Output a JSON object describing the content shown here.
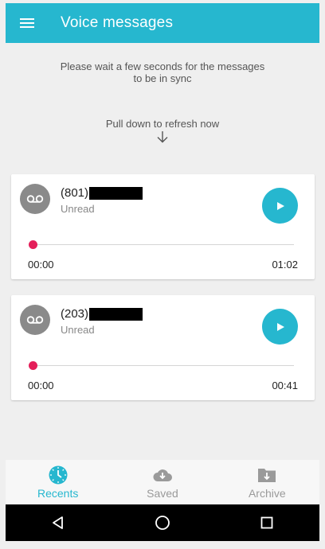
{
  "appbar": {
    "title": "Voice messages"
  },
  "notice": {
    "sync_line1": "Please wait a few seconds for the messages",
    "sync_line2": "to be in sync",
    "refresh": "Pull down to refresh now"
  },
  "messages": [
    {
      "caller": "(801)",
      "status": "Unread",
      "elapsed": "00:00",
      "duration": "01:02",
      "progress": 0
    },
    {
      "caller": "(203)",
      "status": "Unread",
      "elapsed": "00:00",
      "duration": "00:41",
      "progress": 0
    }
  ],
  "nav": {
    "items": [
      {
        "label": "Recents",
        "icon": "clock-icon",
        "active": true
      },
      {
        "label": "Saved",
        "icon": "cloud-download-icon",
        "active": false
      },
      {
        "label": "Archive",
        "icon": "archive-folder-icon",
        "active": false
      }
    ]
  },
  "system_nav": [
    "back-icon",
    "home-icon",
    "recents-icon"
  ],
  "colors": {
    "accent": "#26b7cf",
    "progress_knob": "#e41f5a",
    "avatar": "#8a8a8a"
  }
}
